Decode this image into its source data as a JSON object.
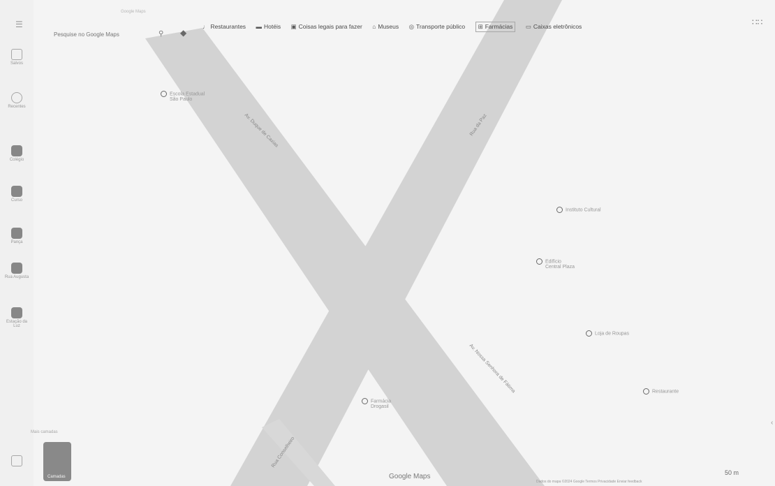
{
  "search": {
    "hint": "Google Maps",
    "placeholder": "Pesquise no Google Maps"
  },
  "chips": [
    {
      "icon": "fork-knife-icon",
      "glyph": "♩",
      "label": "Restaurantes"
    },
    {
      "icon": "bed-icon",
      "glyph": "▬",
      "label": "Hotéis"
    },
    {
      "icon": "camera-icon",
      "glyph": "▣",
      "label": "Coisas legais para fazer"
    },
    {
      "icon": "museum-icon",
      "glyph": "⌂",
      "label": "Museus"
    },
    {
      "icon": "transit-icon",
      "glyph": "◎",
      "label": "Transporte público"
    },
    {
      "icon": "pharmacy-icon",
      "glyph": "⊞",
      "label": "Farmácias"
    },
    {
      "icon": "atm-icon",
      "glyph": "▭",
      "label": "Caixas eletrônicos"
    }
  ],
  "sidebar": [
    {
      "icon": "bookmark-icon",
      "label": "Salvos"
    },
    {
      "icon": "history-icon",
      "label": "Recentes"
    },
    {
      "icon": "place-thumb",
      "label": "Colégio"
    },
    {
      "icon": "place-thumb",
      "label": "Curso"
    },
    {
      "icon": "place-thumb",
      "label": "Pança"
    },
    {
      "icon": "place-thumb",
      "label": "Rua Augusta"
    },
    {
      "icon": "place-thumb",
      "label": "Estação da Luz"
    }
  ],
  "pois": [
    {
      "label1": "Escola Estadual",
      "label2": "São Paulo"
    },
    {
      "label1": "Instituto Cultural",
      "label2": ""
    },
    {
      "label1": "Edifício",
      "label2": "Central Plaza"
    },
    {
      "label1": "Loja de Roupas",
      "label2": ""
    },
    {
      "label1": "Farmácia",
      "label2": "Drogasil"
    },
    {
      "label1": "Restaurante",
      "label2": ""
    }
  ],
  "streets": [
    "Av. Duque de Caxias",
    "Rua da Paz",
    "Av. Nossa Senhora de Fátima",
    "Rua Conselheiro"
  ],
  "layers": {
    "label": "Camadas",
    "hint": "Mais camadas"
  },
  "brand": "Google Maps",
  "footer": {
    "text": "Dados do mapa ©2024 Google  Termos  Privacidade  Enviar feedback",
    "scale": "50 m"
  },
  "colors": {
    "road": "#d6d6d6",
    "background": "#f4f4f4"
  }
}
